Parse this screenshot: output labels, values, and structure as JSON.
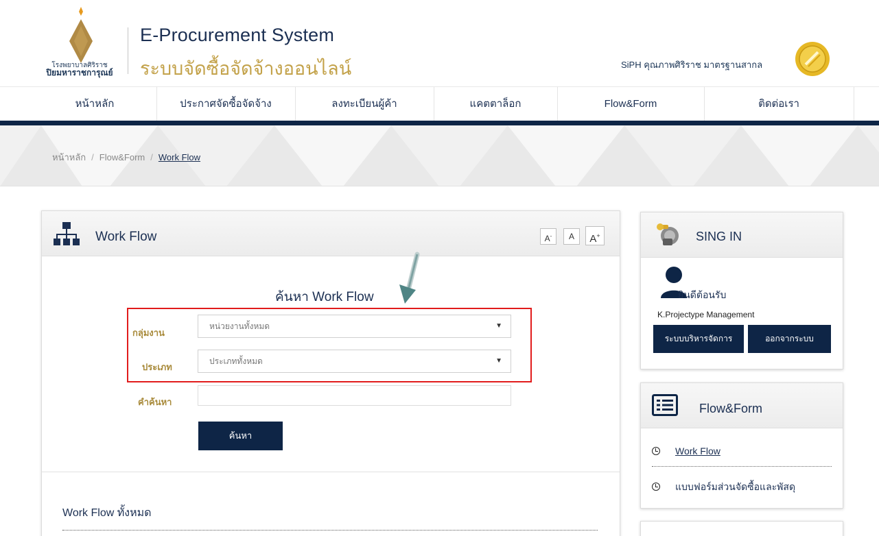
{
  "header": {
    "logo_line1": "โรงพยาบาลศิริราช",
    "logo_line2": "ปิยมหาราชการุณย์",
    "title": "E-Procurement System",
    "subtitle": "ระบบจัดซื้อจัดจ้างออนไลน์",
    "siph_text": "SiPH คุณภาพศิริราช มาตรฐานสากล"
  },
  "nav": {
    "items": [
      "หน้าหลัก",
      "ประกาศจัดซื้อจัดจ้าง",
      "ลงทะเบียนผู้ค้า",
      "แคตตาล็อก",
      "Flow&Form",
      "ติดต่อเรา"
    ]
  },
  "breadcrumb": {
    "home": "หน้าหลัก",
    "section": "Flow&Form",
    "current": "Work Flow",
    "separator": "/"
  },
  "panel": {
    "title": "Work Flow",
    "font_small": "A",
    "font_normal": "A",
    "font_large": "A",
    "search_heading": "ค้นหา Work Flow",
    "group_label": "กลุ่มงาน",
    "group_value": "หน่วยงานทั้งหมด",
    "type_label": "ประเภท",
    "type_value": "ประเภททั้งหมด",
    "keyword_label": "คำค้นหา",
    "keyword_value": "",
    "search_button": "ค้นหา",
    "all_title": "Work Flow ทั้งหมด"
  },
  "signin": {
    "title": "SING IN",
    "welcome": "ยินดีต้อนรับ",
    "user": "K.Projectype Management",
    "admin_button": "ระบบบริหารจัดการ",
    "logout_button": "ออกจากระบบ"
  },
  "flowform": {
    "title": "Flow&Form",
    "links": [
      "Work Flow",
      "แบบฟอร์มส่วนจัดซื้อและพัสดุ"
    ]
  },
  "colors": {
    "navy": "#0e2546",
    "gold": "#c3a24a",
    "highlight_red": "#e11b1b"
  }
}
